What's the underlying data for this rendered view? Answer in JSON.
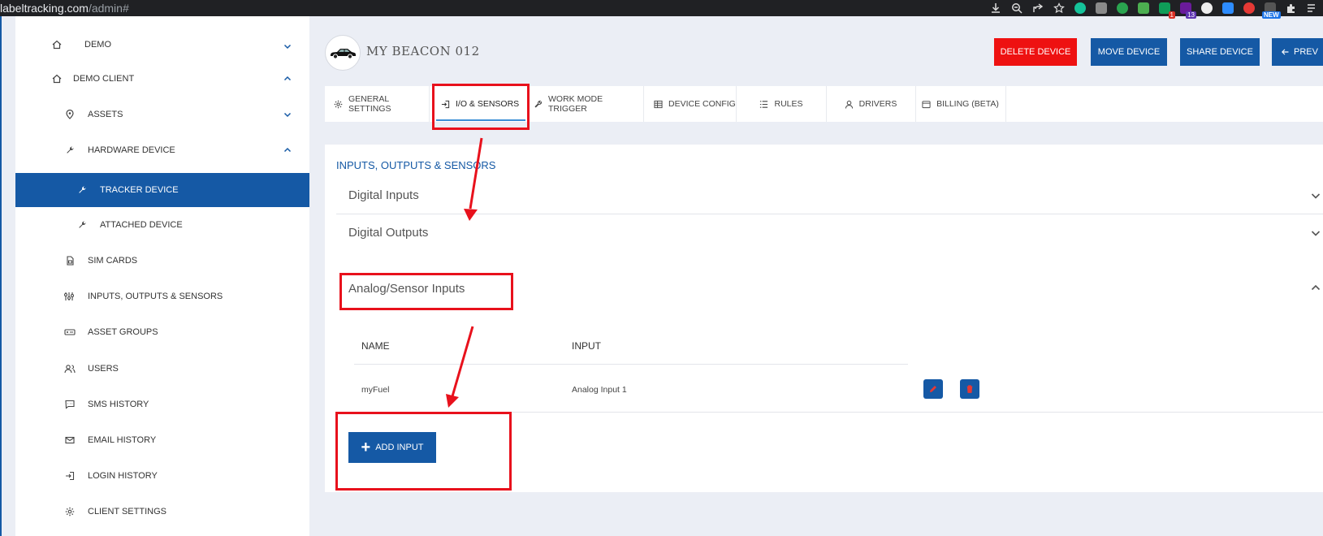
{
  "browser": {
    "url_host": "labeltracking.com",
    "url_path": "/admin#",
    "ext_badges": [
      "1",
      "13",
      "NEW"
    ]
  },
  "sidebar": {
    "items": [
      {
        "label": "DEMO",
        "icon": "home-icon",
        "chevron": "down"
      },
      {
        "label": "DEMO CLIENT",
        "icon": "home-icon",
        "chevron": "up"
      },
      {
        "label": "ASSETS",
        "icon": "map-pin-icon",
        "chevron": "down"
      },
      {
        "label": "HARDWARE DEVICE",
        "icon": "wrench-icon",
        "chevron": "up"
      },
      {
        "label": "TRACKER DEVICE",
        "icon": "wrench-icon",
        "active": true
      },
      {
        "label": "ATTACHED DEVICE",
        "icon": "wrench-icon"
      },
      {
        "label": "SIM CARDS",
        "icon": "sim-card-icon"
      },
      {
        "label": "INPUTS, OUTPUTS & SENSORS",
        "icon": "sliders-icon"
      },
      {
        "label": "ASSET GROUPS",
        "icon": "asset-groups-icon"
      },
      {
        "label": "USERS",
        "icon": "users-icon"
      },
      {
        "label": "SMS HISTORY",
        "icon": "message-icon"
      },
      {
        "label": "EMAIL HISTORY",
        "icon": "mail-icon"
      },
      {
        "label": "LOGIN HISTORY",
        "icon": "login-icon"
      },
      {
        "label": "CLIENT SETTINGS",
        "icon": "gear-icon"
      }
    ]
  },
  "header": {
    "device_name": "MY BEACON 012",
    "buttons": {
      "delete": "DELETE DEVICE",
      "move": "MOVE DEVICE",
      "share": "SHARE DEVICE",
      "prev": "PREV"
    }
  },
  "tabs": [
    {
      "label": "GENERAL SETTINGS",
      "icon": "gear-icon"
    },
    {
      "label": "I/O & SENSORS",
      "icon": "io-icon",
      "active": true
    },
    {
      "label": "WORK MODE TRIGGER",
      "icon": "wrench-icon"
    },
    {
      "label": "DEVICE CONFIG",
      "icon": "table-icon"
    },
    {
      "label": "RULES",
      "icon": "list-icon"
    },
    {
      "label": "DRIVERS",
      "icon": "user-icon"
    },
    {
      "label": "BILLING (BETA)",
      "icon": "billing-icon"
    }
  ],
  "main": {
    "section_title": "INPUTS, OUTPUTS & SENSORS",
    "accordions": {
      "digital_inputs": "Digital Inputs",
      "digital_outputs": "Digital Outputs",
      "analog_inputs": "Analog/Sensor Inputs"
    },
    "table": {
      "headers": [
        "NAME",
        "INPUT"
      ],
      "rows": [
        {
          "name": "myFuel",
          "input": "Analog Input 1"
        }
      ]
    },
    "add_input_label": "ADD INPUT"
  },
  "colors": {
    "brand_blue": "#1559a5",
    "delete_red": "#ee1111",
    "annotation_red": "#e8111c",
    "tab_underline": "#3b8fd6"
  }
}
